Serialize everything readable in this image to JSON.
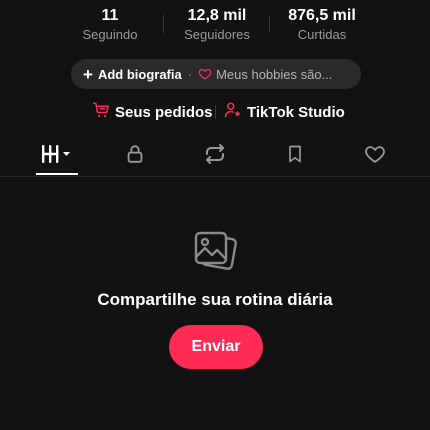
{
  "stats": {
    "following": {
      "value": "11",
      "label": "Seguindo"
    },
    "followers": {
      "value": "12,8 mil",
      "label": "Seguidores"
    },
    "likes": {
      "value": "876,5 mil",
      "label": "Curtidas"
    }
  },
  "bio_pill": {
    "add_label": "Add biografia",
    "separator": "·",
    "hobbies_text": "Meus hobbies são..."
  },
  "links": {
    "orders_label": "Seus pedidos",
    "studio_label": "TikTok Studio"
  },
  "tabs": [
    {
      "name": "posts",
      "icon": "grid-icon",
      "active": true
    },
    {
      "name": "private",
      "icon": "lock-icon",
      "active": false
    },
    {
      "name": "reposts",
      "icon": "repost-icon",
      "active": false
    },
    {
      "name": "saved",
      "icon": "bookmark-icon",
      "active": false
    },
    {
      "name": "liked",
      "icon": "heart-icon",
      "active": false
    }
  ],
  "empty_state": {
    "title": "Compartilhe sua rotina diária",
    "button_label": "Enviar"
  },
  "colors": {
    "background": "#121212",
    "accent": "#fe2c55",
    "pill": "#2a2a2a",
    "muted_text": "#9a9a9a"
  }
}
